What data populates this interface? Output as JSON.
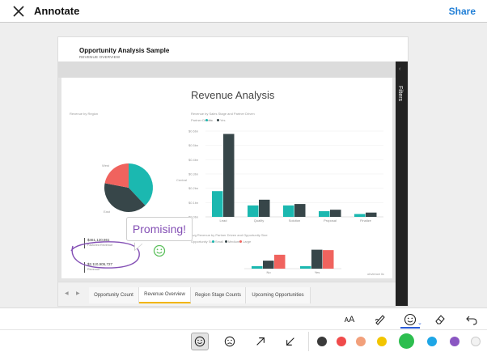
{
  "header": {
    "title": "Annotate",
    "share_label": "Share"
  },
  "report": {
    "title": "Opportunity Analysis Sample",
    "subtitle": "REVENUE OVERVIEW",
    "filters_label": "Filters",
    "canvas_title": "Revenue Analysis",
    "pie": {
      "title": "Revenue by Region",
      "labels": [
        "West",
        "Central",
        "East"
      ]
    },
    "bar_chart_1": {
      "title": "Revenue by Sales Stage and Partner Driven",
      "legend_title": "Partner Driven",
      "legend": [
        "No",
        "Yes"
      ]
    },
    "bar_chart_2": {
      "title": "Avg Revenue by Partner Driven and Opportunity Size",
      "legend_title": "Opportunity Size",
      "legend": [
        "Small",
        "Medium",
        "Large"
      ]
    },
    "cards": [
      {
        "value": "$461,120,861",
        "caption": "Factored Revenue"
      },
      {
        "value": "$2,110,905,727",
        "caption": "Revenue"
      },
      {
        "value": "687",
        "caption": "Opportunity Count"
      }
    ],
    "tabs": [
      "Opportunity Count",
      "Revenue Overview",
      "Region Stage Counts",
      "Upcoming Opportunities"
    ],
    "active_tab": "Revenue Overview",
    "footer_label": "obvience llc"
  },
  "annotation": {
    "sticker_text": "Promising!",
    "colors": {
      "ink": "#8450b5",
      "sticker": "#5cc05c"
    }
  },
  "toolbar": {
    "tools": [
      "text-size",
      "pen",
      "stickers",
      "eraser",
      "undo"
    ],
    "selected_tool": "stickers",
    "shapes": [
      "smile",
      "frown",
      "arrow-up-right",
      "arrow-down-left"
    ],
    "selected_shape": "smile",
    "palette": [
      "#3a3a3a",
      "#f04b4b",
      "#f2a07b",
      "#f2c500",
      "#2dbe4f",
      "#1ea6e6",
      "#8a56c2",
      "#f2f2f2"
    ],
    "selected_color": "#2dbe4f"
  },
  "chart_data": [
    {
      "type": "pie",
      "title": "Revenue by Region",
      "categories": [
        "Central",
        "East",
        "West"
      ],
      "values": [
        38,
        40,
        22
      ]
    },
    {
      "type": "bar",
      "title": "Revenue by Sales Stage and Partner Driven",
      "categories": [
        "Lead",
        "Qualify",
        "Solution",
        "Proposal",
        "Finalize"
      ],
      "series": [
        {
          "name": "No",
          "values": [
            0.18,
            0.08,
            0.08,
            0.04,
            0.02
          ]
        },
        {
          "name": "Yes",
          "values": [
            0.58,
            0.12,
            0.09,
            0.05,
            0.03
          ]
        }
      ],
      "y_ticks": [
        "$0.0bn",
        "$0.1bn",
        "$0.2bn",
        "$0.3bn",
        "$0.4bn",
        "$0.5bn",
        "$0.6bn"
      ],
      "ylim": [
        0,
        0.6
      ],
      "legend_placement": "top-left"
    },
    {
      "type": "bar",
      "title": "Avg Revenue by Partner Driven and Opportunity Size",
      "categories": [
        "No",
        "Yes"
      ],
      "series": [
        {
          "name": "Small",
          "values": [
            0.6,
            0.6
          ]
        },
        {
          "name": "Medium",
          "values": [
            1.9,
            4.5
          ]
        },
        {
          "name": "Large",
          "values": [
            3.3,
            4.4
          ]
        }
      ],
      "ylim": [
        0,
        5
      ],
      "legend_placement": "top-left"
    }
  ]
}
